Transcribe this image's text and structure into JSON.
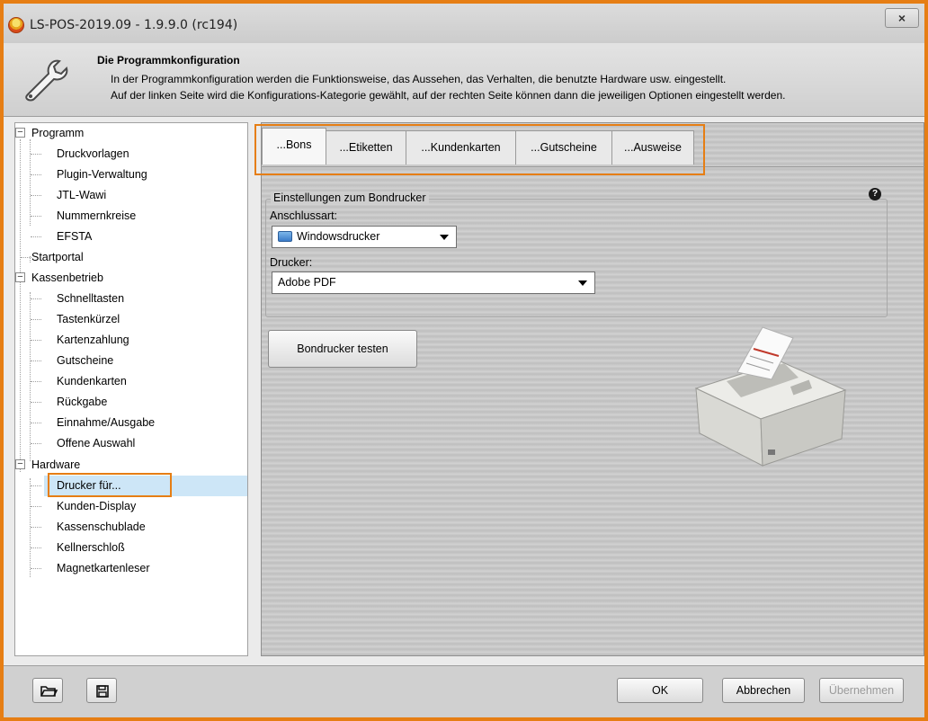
{
  "window": {
    "title": "LS-POS-2019.09 - 1.9.9.0 (rc194)",
    "close_label": "×"
  },
  "header": {
    "title": "Die Programmkonfiguration",
    "line1": "In der Programmkonfiguration werden die Funktionsweise, das Aussehen, das Verhalten, die benutzte Hardware usw. eingestellt.",
    "line2": "Auf der linken Seite wird die Konfigurations-Kategorie gewählt, auf der rechten Seite können dann die jeweiligen Optionen eingestellt werden."
  },
  "tree": {
    "items": [
      {
        "label": "Programm"
      },
      {
        "label": "Druckvorlagen"
      },
      {
        "label": "Plugin-Verwaltung"
      },
      {
        "label": "JTL-Wawi"
      },
      {
        "label": "Nummernkreise"
      },
      {
        "label": "EFSTA"
      },
      {
        "label": "Startportal"
      },
      {
        "label": "Kassenbetrieb"
      },
      {
        "label": "Schnelltasten"
      },
      {
        "label": "Tastenkürzel"
      },
      {
        "label": "Kartenzahlung"
      },
      {
        "label": "Gutscheine"
      },
      {
        "label": "Kundenkarten"
      },
      {
        "label": "Rückgabe"
      },
      {
        "label": "Einnahme/Ausgabe"
      },
      {
        "label": "Offene Auswahl"
      },
      {
        "label": "Hardware"
      },
      {
        "label": "Drucker für..."
      },
      {
        "label": "Kunden-Display"
      },
      {
        "label": "Kassenschublade"
      },
      {
        "label": "Kellnerschloß"
      },
      {
        "label": "Magnetkartenleser"
      }
    ],
    "toggle_symbol": "−"
  },
  "tabs": [
    {
      "label": "...Bons"
    },
    {
      "label": "...Etiketten"
    },
    {
      "label": "...Kundenkarten"
    },
    {
      "label": "...Gutscheine"
    },
    {
      "label": "...Ausweise"
    }
  ],
  "bondrucker": {
    "group_title": "Einstellungen zum Bondrucker",
    "connection_label": "Anschlussart:",
    "connection_value": "Windowsdrucker",
    "printer_label": "Drucker:",
    "printer_value": "Adobe PDF",
    "test_button": "Bondrucker testen",
    "help_symbol": "?"
  },
  "footer": {
    "ok": "OK",
    "cancel": "Abbrechen",
    "apply": "Übernehmen"
  },
  "colors": {
    "highlight_orange": "#e67e14",
    "selection_blue": "#cde6f7"
  }
}
